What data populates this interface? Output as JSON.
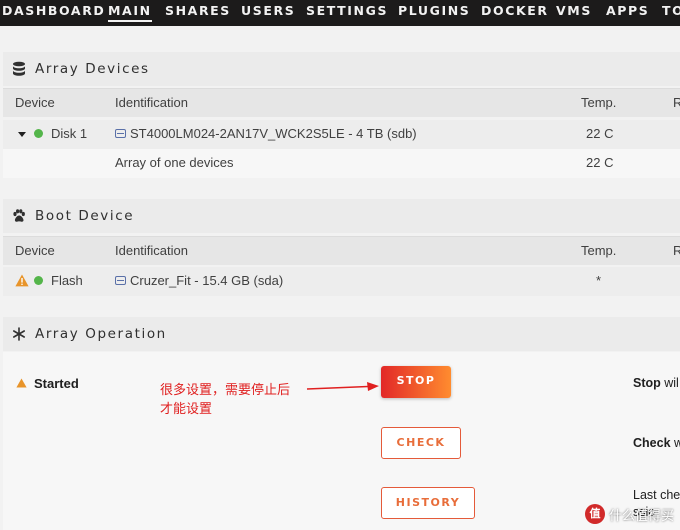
{
  "nav": {
    "items": [
      "DASHBOARD",
      "MAIN",
      "SHARES",
      "USERS",
      "SETTINGS",
      "PLUGINS",
      "DOCKER",
      "VMS",
      "APPS",
      "TO"
    ]
  },
  "array_devices": {
    "title": "Array Devices",
    "columns": {
      "device": "Device",
      "identification": "Identification",
      "temp": "Temp.",
      "more": "R"
    },
    "rows": [
      {
        "device": "Disk 1",
        "identification": "ST4000LM024-2AN17V_WCK2S5LE - 4 TB (sdb)",
        "temp": "22 C"
      },
      {
        "device": "",
        "identification": "Array of one devices",
        "temp": "22 C"
      }
    ]
  },
  "boot_device": {
    "title": "Boot Device",
    "columns": {
      "device": "Device",
      "identification": "Identification",
      "temp": "Temp.",
      "more": "R"
    },
    "rows": [
      {
        "device": "Flash",
        "identification": "Cruzer_Fit - 15.4 GB (sda)",
        "temp": "*"
      }
    ]
  },
  "array_operation": {
    "title": "Array Operation",
    "status": "Started",
    "stop_button": "STOP",
    "check_button": "CHECK",
    "history_button": "HISTORY",
    "stop_desc_bold": "Stop",
    "stop_desc_rest": " wil",
    "check_desc_bold": "Check",
    "check_desc_rest": " w",
    "history_desc_line1": "Last che",
    "history_desc_line2": "ssio"
  },
  "annotation": {
    "line1": "很多设置，需要停止后",
    "line2": "才能设置"
  },
  "watermark": {
    "logo": "值",
    "text": "什么值得买"
  },
  "colors": {
    "nav_bg": "#1c1b1b",
    "accent_red": "#e22828",
    "accent_orange": "#ff8c2f",
    "status_green": "#54b54a",
    "warning_orange": "#e8942a",
    "link_blue": "#486dba",
    "annotation_red": "#e02020"
  }
}
